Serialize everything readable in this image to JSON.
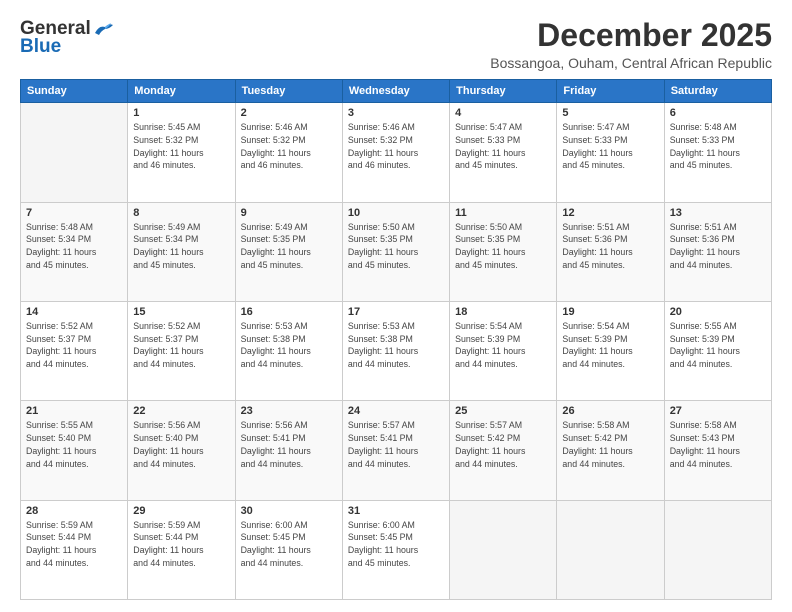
{
  "header": {
    "logo_general": "General",
    "logo_blue": "Blue",
    "month": "December 2025",
    "location": "Bossangoa, Ouham, Central African Republic"
  },
  "days_of_week": [
    "Sunday",
    "Monday",
    "Tuesday",
    "Wednesday",
    "Thursday",
    "Friday",
    "Saturday"
  ],
  "weeks": [
    [
      {
        "day": "",
        "info": ""
      },
      {
        "day": "1",
        "info": "Sunrise: 5:45 AM\nSunset: 5:32 PM\nDaylight: 11 hours\nand 46 minutes."
      },
      {
        "day": "2",
        "info": "Sunrise: 5:46 AM\nSunset: 5:32 PM\nDaylight: 11 hours\nand 46 minutes."
      },
      {
        "day": "3",
        "info": "Sunrise: 5:46 AM\nSunset: 5:32 PM\nDaylight: 11 hours\nand 46 minutes."
      },
      {
        "day": "4",
        "info": "Sunrise: 5:47 AM\nSunset: 5:33 PM\nDaylight: 11 hours\nand 45 minutes."
      },
      {
        "day": "5",
        "info": "Sunrise: 5:47 AM\nSunset: 5:33 PM\nDaylight: 11 hours\nand 45 minutes."
      },
      {
        "day": "6",
        "info": "Sunrise: 5:48 AM\nSunset: 5:33 PM\nDaylight: 11 hours\nand 45 minutes."
      }
    ],
    [
      {
        "day": "7",
        "info": "Sunrise: 5:48 AM\nSunset: 5:34 PM\nDaylight: 11 hours\nand 45 minutes."
      },
      {
        "day": "8",
        "info": "Sunrise: 5:49 AM\nSunset: 5:34 PM\nDaylight: 11 hours\nand 45 minutes."
      },
      {
        "day": "9",
        "info": "Sunrise: 5:49 AM\nSunset: 5:35 PM\nDaylight: 11 hours\nand 45 minutes."
      },
      {
        "day": "10",
        "info": "Sunrise: 5:50 AM\nSunset: 5:35 PM\nDaylight: 11 hours\nand 45 minutes."
      },
      {
        "day": "11",
        "info": "Sunrise: 5:50 AM\nSunset: 5:35 PM\nDaylight: 11 hours\nand 45 minutes."
      },
      {
        "day": "12",
        "info": "Sunrise: 5:51 AM\nSunset: 5:36 PM\nDaylight: 11 hours\nand 45 minutes."
      },
      {
        "day": "13",
        "info": "Sunrise: 5:51 AM\nSunset: 5:36 PM\nDaylight: 11 hours\nand 44 minutes."
      }
    ],
    [
      {
        "day": "14",
        "info": "Sunrise: 5:52 AM\nSunset: 5:37 PM\nDaylight: 11 hours\nand 44 minutes."
      },
      {
        "day": "15",
        "info": "Sunrise: 5:52 AM\nSunset: 5:37 PM\nDaylight: 11 hours\nand 44 minutes."
      },
      {
        "day": "16",
        "info": "Sunrise: 5:53 AM\nSunset: 5:38 PM\nDaylight: 11 hours\nand 44 minutes."
      },
      {
        "day": "17",
        "info": "Sunrise: 5:53 AM\nSunset: 5:38 PM\nDaylight: 11 hours\nand 44 minutes."
      },
      {
        "day": "18",
        "info": "Sunrise: 5:54 AM\nSunset: 5:39 PM\nDaylight: 11 hours\nand 44 minutes."
      },
      {
        "day": "19",
        "info": "Sunrise: 5:54 AM\nSunset: 5:39 PM\nDaylight: 11 hours\nand 44 minutes."
      },
      {
        "day": "20",
        "info": "Sunrise: 5:55 AM\nSunset: 5:39 PM\nDaylight: 11 hours\nand 44 minutes."
      }
    ],
    [
      {
        "day": "21",
        "info": "Sunrise: 5:55 AM\nSunset: 5:40 PM\nDaylight: 11 hours\nand 44 minutes."
      },
      {
        "day": "22",
        "info": "Sunrise: 5:56 AM\nSunset: 5:40 PM\nDaylight: 11 hours\nand 44 minutes."
      },
      {
        "day": "23",
        "info": "Sunrise: 5:56 AM\nSunset: 5:41 PM\nDaylight: 11 hours\nand 44 minutes."
      },
      {
        "day": "24",
        "info": "Sunrise: 5:57 AM\nSunset: 5:41 PM\nDaylight: 11 hours\nand 44 minutes."
      },
      {
        "day": "25",
        "info": "Sunrise: 5:57 AM\nSunset: 5:42 PM\nDaylight: 11 hours\nand 44 minutes."
      },
      {
        "day": "26",
        "info": "Sunrise: 5:58 AM\nSunset: 5:42 PM\nDaylight: 11 hours\nand 44 minutes."
      },
      {
        "day": "27",
        "info": "Sunrise: 5:58 AM\nSunset: 5:43 PM\nDaylight: 11 hours\nand 44 minutes."
      }
    ],
    [
      {
        "day": "28",
        "info": "Sunrise: 5:59 AM\nSunset: 5:44 PM\nDaylight: 11 hours\nand 44 minutes."
      },
      {
        "day": "29",
        "info": "Sunrise: 5:59 AM\nSunset: 5:44 PM\nDaylight: 11 hours\nand 44 minutes."
      },
      {
        "day": "30",
        "info": "Sunrise: 6:00 AM\nSunset: 5:45 PM\nDaylight: 11 hours\nand 44 minutes."
      },
      {
        "day": "31",
        "info": "Sunrise: 6:00 AM\nSunset: 5:45 PM\nDaylight: 11 hours\nand 45 minutes."
      },
      {
        "day": "",
        "info": ""
      },
      {
        "day": "",
        "info": ""
      },
      {
        "day": "",
        "info": ""
      }
    ]
  ]
}
